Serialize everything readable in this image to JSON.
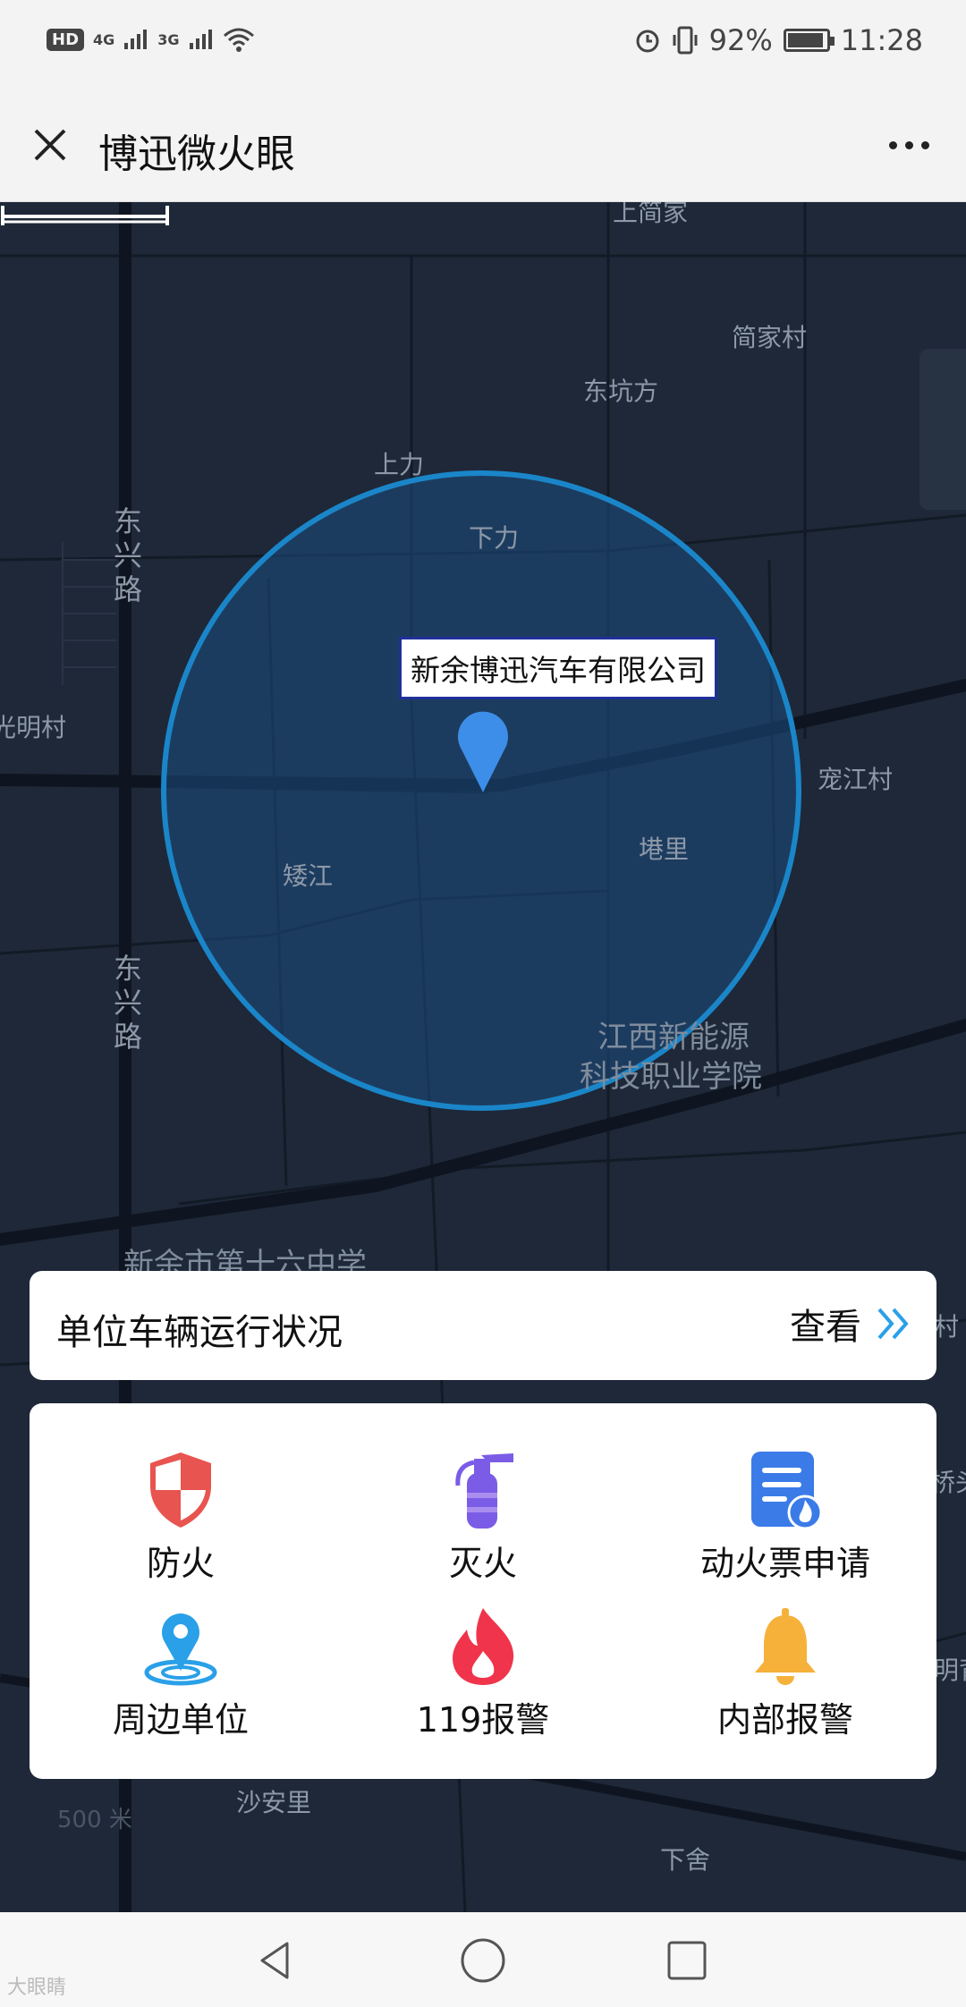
{
  "status_bar": {
    "left_badge": "HD",
    "sig1": "4G",
    "sig2": "3G",
    "battery": "92%",
    "battery_level": 0.92,
    "time": "11:28"
  },
  "header": {
    "title": "博迅微火眼"
  },
  "map": {
    "labels": {
      "shangjian": "上简家",
      "jianjiacun": "简家村",
      "dongkengfang": "东坑方",
      "shangli": "上力",
      "xiali": "下力",
      "dongxinglu_top": "东兴路",
      "guangmingcun": "光明村",
      "aijiang": "矮江",
      "lingli": "塂里",
      "chongjiangcun": "宠江村",
      "dongxinglu_bottom": "东兴路",
      "college_line1": "江西新能源",
      "college_line2": "科技职业学院",
      "school": "新余市第十六中学",
      "shaanli": "沙安里",
      "xiashe": "下舍",
      "edge_right1": "村",
      "edge_right2": "桥头",
      "edge_right3": "明背"
    },
    "company_tag": "新余博迅汽车有限公司",
    "scale_label": "500 米"
  },
  "vehicle_status": {
    "title": "单位车辆运行状况",
    "view_label": "查看"
  },
  "actions": [
    {
      "label": "防火",
      "icon": "shield-icon"
    },
    {
      "label": "灭火",
      "icon": "fire-extinguisher-icon"
    },
    {
      "label": "动火票申请",
      "icon": "permit-document-icon"
    },
    {
      "label": "周边单位",
      "icon": "location-pin-icon"
    },
    {
      "label": "119报警",
      "icon": "flame-icon"
    },
    {
      "label": "内部报警",
      "icon": "bell-icon"
    }
  ],
  "watermark": "大眼睛",
  "colors": {
    "map_bg": "#1e2838",
    "circle": "#1a86c9",
    "pin": "#3d8ee8",
    "shield": "#e8544f",
    "extinguisher": "#7b5ce6",
    "document": "#3a7be8",
    "location": "#2aa0e8",
    "flame": "#f0344c",
    "bell": "#f5b13a"
  }
}
